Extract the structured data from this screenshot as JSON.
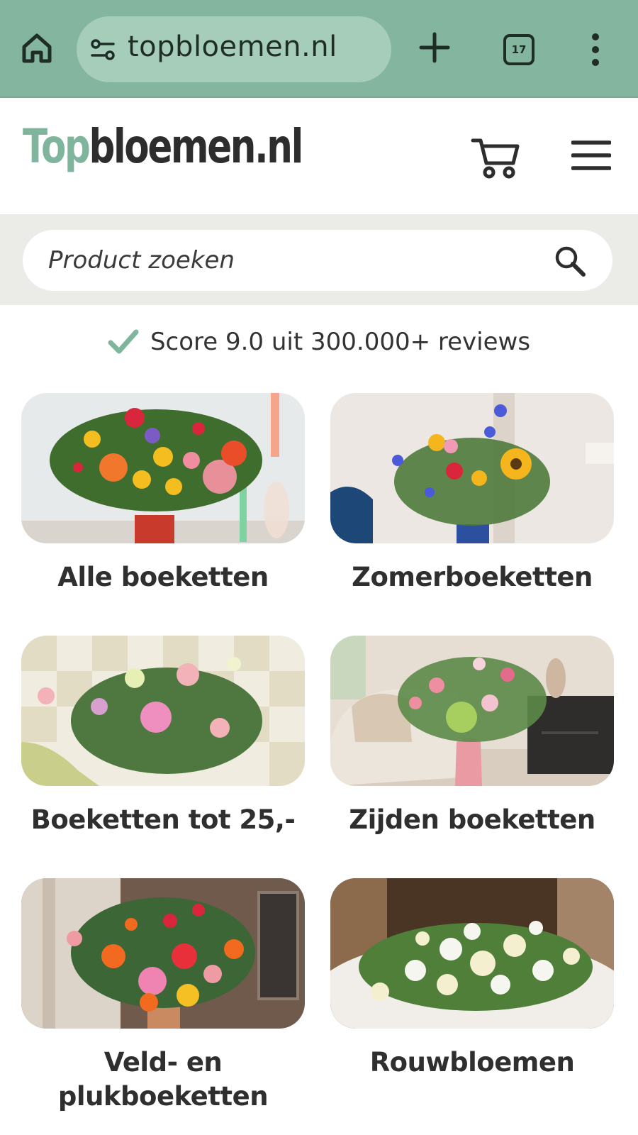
{
  "browser": {
    "url_text": "topbloemen.nl",
    "tab_count": "17",
    "home_icon": "home-icon",
    "site_info_icon": "site-settings-icon",
    "new_tab_icon": "plus-icon",
    "menu_icon": "kebab-menu-icon",
    "bar_color": "#84b59f"
  },
  "header": {
    "logo_part1": "Top",
    "logo_part2": "bloemen.nl",
    "cart_icon": "cart-icon",
    "menu_icon": "hamburger-menu-icon",
    "brand_color": "#7fb49d"
  },
  "search": {
    "placeholder": "Product zoeken",
    "icon": "search-icon"
  },
  "score": {
    "text": "Score 9.0 uit 300.000+ reviews",
    "icon": "check-icon",
    "accent": "#7fb49d"
  },
  "categories": [
    {
      "label": "Alle boeketten"
    },
    {
      "label": "Zomerboeketten"
    },
    {
      "label": "Boeketten tot 25,-"
    },
    {
      "label": "Zijden boeketten"
    },
    {
      "label": "Veld- en plukboeketten"
    },
    {
      "label": "Rouwbloemen"
    }
  ]
}
